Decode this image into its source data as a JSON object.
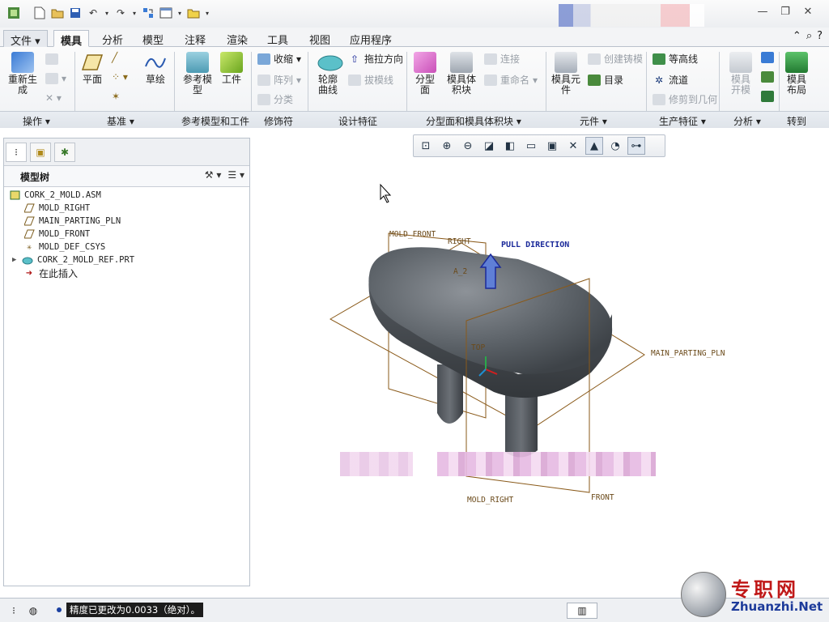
{
  "quick_access": {
    "icons": [
      "app-icon",
      "new-icon",
      "open-icon",
      "save-icon",
      "undo-icon",
      "redo-icon",
      "regenerate-icon",
      "window-icon",
      "folder-icon",
      "more-icon"
    ]
  },
  "menu": {
    "file": "文件",
    "tabs": [
      "模具",
      "分析",
      "模型",
      "注释",
      "渲染",
      "工具",
      "视图",
      "应用程序"
    ],
    "active": "模具"
  },
  "ribbon": {
    "operations": {
      "regenerate": "重新生\n成"
    },
    "datum": {
      "plane": "平面",
      "sketch": "草绘"
    },
    "refmodel": {
      "refmodel": "参考模\n型",
      "workpiece": "工件"
    },
    "cosmetic": {
      "shrink": "收缩",
      "pattern": "阵列",
      "classify": "分类"
    },
    "design": {
      "silhouette": "轮廓\n曲线",
      "pull": "拖拉方向",
      "draft": "拔模线"
    },
    "parting": {
      "parting_surface": "分型\n面",
      "mold_volume": "模具体\n积块",
      "connect": "连接",
      "rename": "重命名"
    },
    "components": {
      "mold_component": "模具元\n件",
      "create_casting": "创建铸模",
      "catalog": "目录"
    },
    "production": {
      "waterline": "等高线",
      "runner": "流道",
      "trim": "修剪到几何"
    },
    "analysis": {
      "mold_open": "模具\n开模"
    },
    "goto": {
      "layout": "模具\n布局"
    },
    "groups": [
      "操作",
      "基准",
      "参考模型和工件",
      "修饰符",
      "设计特征",
      "分型面和模具体积块",
      "元件",
      "生产特征",
      "分析",
      "转到"
    ]
  },
  "panel": {
    "title": "模型树",
    "tree": [
      {
        "label": "CORK_2_MOLD.ASM",
        "icon": "assembly-icon"
      },
      {
        "label": "MOLD_RIGHT",
        "icon": "datum-plane-icon"
      },
      {
        "label": "MAIN_PARTING_PLN",
        "icon": "datum-plane-icon"
      },
      {
        "label": "MOLD_FRONT",
        "icon": "datum-plane-icon"
      },
      {
        "label": "MOLD_DEF_CSYS",
        "icon": "csys-icon"
      },
      {
        "label": "CORK_2_MOLD_REF.PRT",
        "icon": "part-icon"
      },
      {
        "label": "在此插入",
        "icon": "insert-arrow-icon"
      }
    ]
  },
  "graphics": {
    "labels": {
      "mold_front": "MOLD_FRONT",
      "right": "RIGHT",
      "pull_direction": "PULL DIRECTION",
      "main_parting": "MAIN_PARTING_PLN",
      "mold_right": "MOLD_RIGHT",
      "front": "FRONT",
      "top": "TOP",
      "a2": "A_2"
    }
  },
  "status": {
    "message": "精度已更改为0.0033（绝对）。"
  },
  "watermark": {
    "cn": "专职网",
    "en": "Zhuanzhi.Net"
  }
}
